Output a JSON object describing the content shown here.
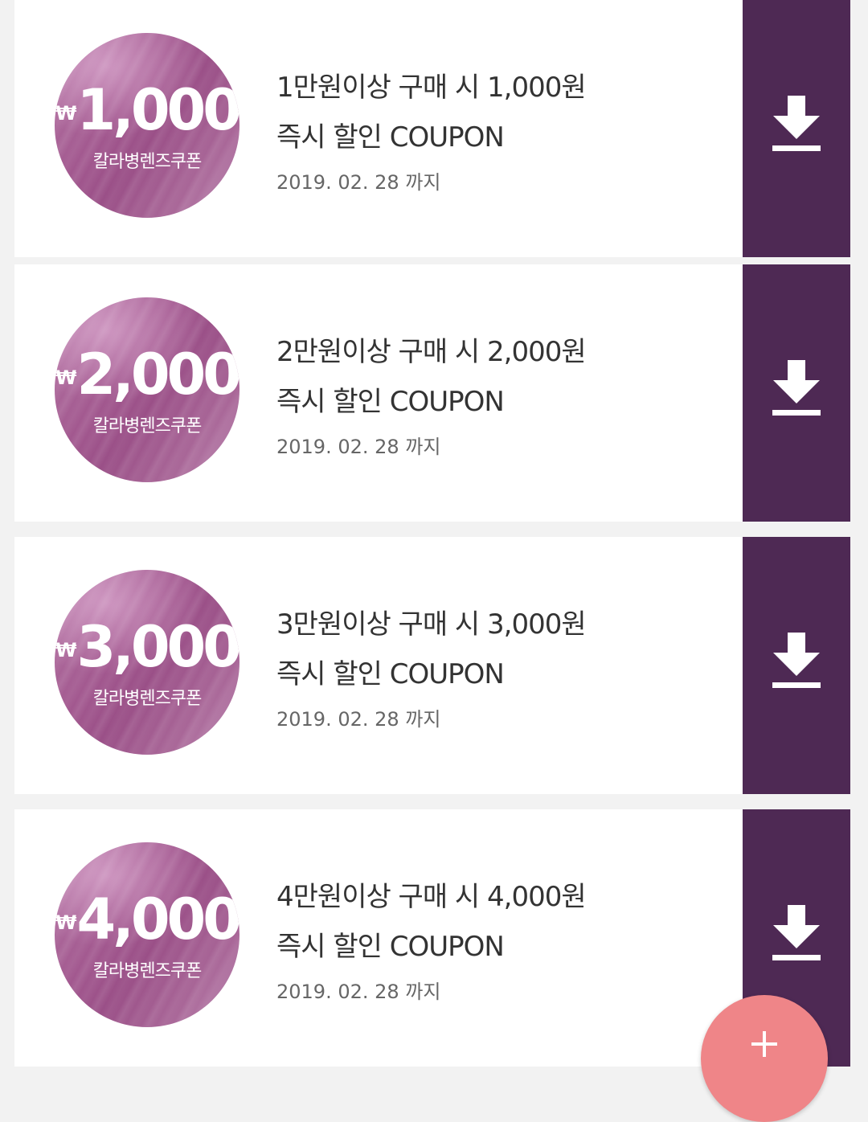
{
  "colors": {
    "background": "#f2f2f2",
    "card": "#ffffff",
    "download_bar": "#4e2954",
    "badge_main": "#a2588f",
    "fab": "#ef8588",
    "text_primary": "#333333",
    "text_secondary": "#666666"
  },
  "icons": {
    "download": "download-icon",
    "add": "plus-icon"
  },
  "coupons": [
    {
      "currency_symbol": "₩",
      "amount": "1,000",
      "badge_label": "칼라병렌즈쿠폰",
      "condition": "1만원이상 구매 시 1,000원",
      "title": "즉시 할인 COUPON",
      "expiry": "2019. 02. 28 까지"
    },
    {
      "currency_symbol": "₩",
      "amount": "2,000",
      "badge_label": "칼라병렌즈쿠폰",
      "condition": "2만원이상 구매 시 2,000원",
      "title": "즉시 할인 COUPON",
      "expiry": "2019. 02. 28 까지"
    },
    {
      "currency_symbol": "₩",
      "amount": "3,000",
      "badge_label": "칼라병렌즈쿠폰",
      "condition": "3만원이상 구매 시 3,000원",
      "title": "즉시 할인 COUPON",
      "expiry": "2019. 02. 28 까지"
    },
    {
      "currency_symbol": "₩",
      "amount": "4,000",
      "badge_label": "칼라병렌즈쿠폰",
      "condition": "4만원이상 구매 시 4,000원",
      "title": "즉시 할인 COUPON",
      "expiry": "2019. 02. 28 까지"
    }
  ]
}
